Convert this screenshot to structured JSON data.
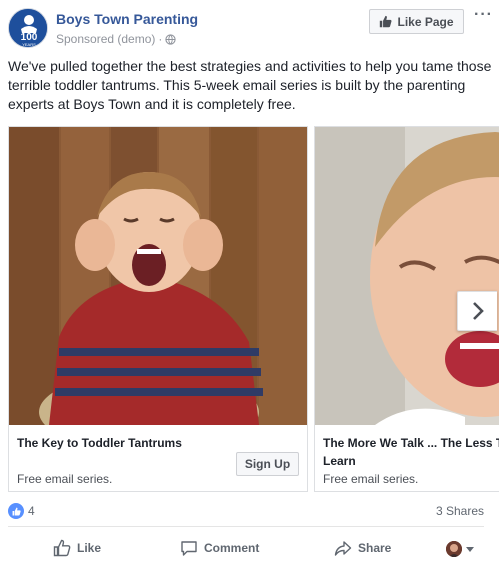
{
  "header": {
    "page_name": "Boys Town Parenting",
    "sponsored_label": "Sponsored (demo)",
    "separator": "·",
    "avatar_badge": "100",
    "avatar_badge_sub": "YEARS",
    "like_page_label": "Like Page",
    "more_label": "···"
  },
  "post": {
    "text": "We've pulled together the best strategies and activities to help you tame those terrible toddler tantrums. This 5-week email series is built by the parenting experts at Boys Town and it is completely free."
  },
  "carousel": {
    "cards": [
      {
        "title": "The Key to Toddler Tantrums",
        "description": "Free email series.",
        "cta": "Sign Up"
      },
      {
        "title": "The More We Talk ... The Less T Learn",
        "description": "Free email series."
      }
    ]
  },
  "stats": {
    "reactions_count": "4",
    "shares": "3 Shares"
  },
  "actions": {
    "like": "Like",
    "comment": "Comment",
    "share": "Share"
  },
  "colors": {
    "link": "#365899",
    "like_blue": "#5890ff",
    "muted": "#606770"
  },
  "icons": {
    "globe": "globe-icon",
    "thumbs_up": "thumbs-up-icon",
    "comment": "comment-icon",
    "share": "share-icon",
    "chevron_right": "chevron-right-icon"
  }
}
